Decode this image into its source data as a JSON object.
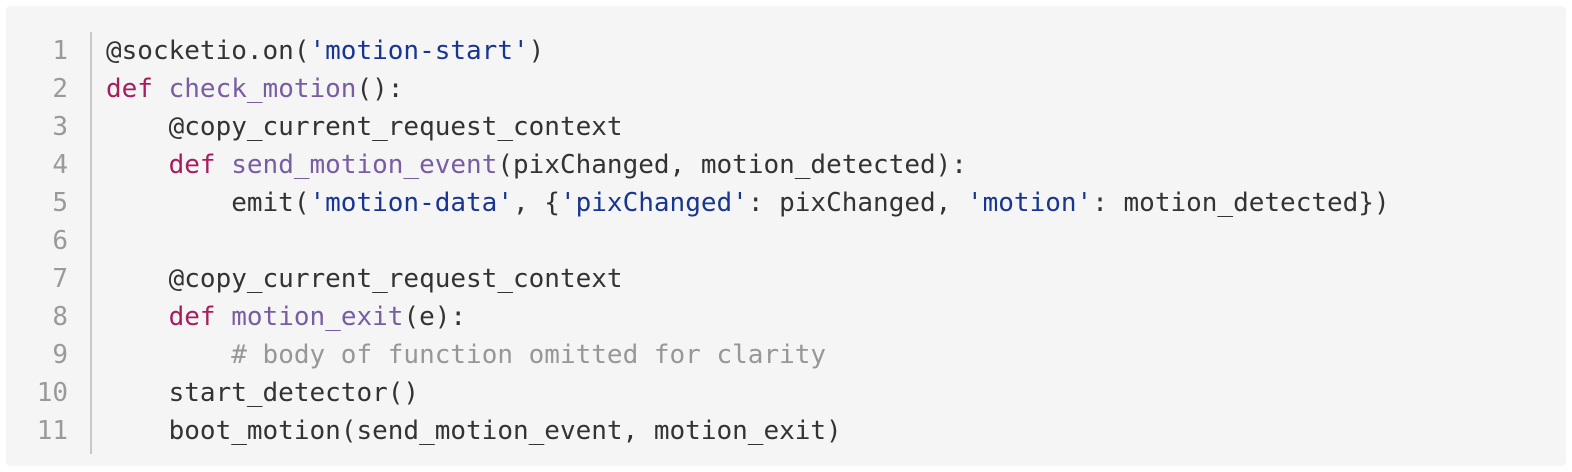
{
  "line_numbers": [
    "1",
    "2",
    "3",
    "4",
    "5",
    "6",
    "7",
    "8",
    "9",
    "10",
    "11"
  ],
  "lines": [
    [
      {
        "t": "@socketio.on(",
        "c": "pl"
      },
      {
        "t": "'motion-start'",
        "c": "str"
      },
      {
        "t": ")",
        "c": "pl"
      }
    ],
    [
      {
        "t": "def",
        "c": "kw"
      },
      {
        "t": " ",
        "c": "pl"
      },
      {
        "t": "check_motion",
        "c": "fn"
      },
      {
        "t": "():",
        "c": "pl"
      }
    ],
    [
      {
        "t": "    @copy_current_request_context",
        "c": "pl"
      }
    ],
    [
      {
        "t": "    ",
        "c": "pl"
      },
      {
        "t": "def",
        "c": "kw"
      },
      {
        "t": " ",
        "c": "pl"
      },
      {
        "t": "send_motion_event",
        "c": "fn"
      },
      {
        "t": "(pixChanged, motion_detected):",
        "c": "pl"
      }
    ],
    [
      {
        "t": "        emit(",
        "c": "pl"
      },
      {
        "t": "'motion-data'",
        "c": "str"
      },
      {
        "t": ", {",
        "c": "pl"
      },
      {
        "t": "'pixChanged'",
        "c": "str"
      },
      {
        "t": ": pixChanged, ",
        "c": "pl"
      },
      {
        "t": "'motion'",
        "c": "str"
      },
      {
        "t": ": motion_detected})",
        "c": "pl"
      }
    ],
    [
      {
        "t": "",
        "c": "pl"
      }
    ],
    [
      {
        "t": "    @copy_current_request_context",
        "c": "pl"
      }
    ],
    [
      {
        "t": "    ",
        "c": "pl"
      },
      {
        "t": "def",
        "c": "kw"
      },
      {
        "t": " ",
        "c": "pl"
      },
      {
        "t": "motion_exit",
        "c": "fn"
      },
      {
        "t": "(e):",
        "c": "pl"
      }
    ],
    [
      {
        "t": "        ",
        "c": "pl"
      },
      {
        "t": "# body of function omitted for clarity",
        "c": "cm"
      }
    ],
    [
      {
        "t": "    start_detector()",
        "c": "pl"
      }
    ],
    [
      {
        "t": "    boot_motion(send_motion_event, motion_exit)",
        "c": "pl"
      }
    ]
  ],
  "colors": {
    "background": "#f5f5f5",
    "keyword": "#a71d5d",
    "function_name": "#795da3",
    "string": "#183691",
    "comment": "#969896",
    "plain": "#333333",
    "line_number": "#9a9a9a"
  }
}
